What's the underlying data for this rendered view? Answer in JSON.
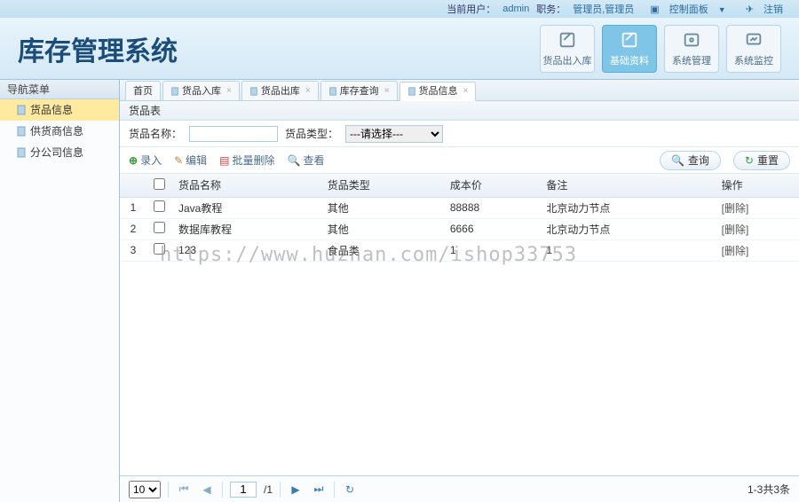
{
  "header": {
    "current_user_label": "当前用户：",
    "current_user": "admin",
    "role_label": "职务：",
    "role": "管理员,管理员",
    "control_panel": "控制面板",
    "logout": "注销"
  },
  "banner": {
    "title": "库存管理系统",
    "buttons": [
      {
        "label": "货品出入库"
      },
      {
        "label": "基础资料"
      },
      {
        "label": "系统管理"
      },
      {
        "label": "系统监控"
      }
    ]
  },
  "sidebar": {
    "title": "导航菜单",
    "items": [
      {
        "label": "货品信息"
      },
      {
        "label": "供货商信息"
      },
      {
        "label": "分公司信息"
      }
    ]
  },
  "tabs": [
    {
      "label": "首页",
      "closable": false
    },
    {
      "label": "货品入库",
      "closable": true
    },
    {
      "label": "货品出库",
      "closable": true
    },
    {
      "label": "库存查询",
      "closable": true
    },
    {
      "label": "货品信息",
      "closable": true
    }
  ],
  "panel": {
    "title": "货品表"
  },
  "search": {
    "name_label": "货品名称：",
    "type_label": "货品类型：",
    "type_placeholder": "---请选择---"
  },
  "toolbar": {
    "add": "录入",
    "edit": "编辑",
    "batch_delete": "批量删除",
    "view": "查看",
    "search": "查询",
    "reset": "重置"
  },
  "table": {
    "columns": [
      "货品名称",
      "货品类型",
      "成本价",
      "备注",
      "操作"
    ],
    "rows": [
      {
        "num": "1",
        "name": "Java教程",
        "type": "其他",
        "price": "88888",
        "remark": "北京动力节点",
        "op": "[删除]"
      },
      {
        "num": "2",
        "name": "数据库教程",
        "type": "其他",
        "price": "6666",
        "remark": "北京动力节点",
        "op": "[删除]"
      },
      {
        "num": "3",
        "name": "123",
        "type": "食品类",
        "price": "1",
        "remark": "1",
        "op": "[删除]"
      }
    ]
  },
  "pager": {
    "page_size": "10",
    "page": "1",
    "total_pages": "/1",
    "info": "1-3共3条"
  },
  "watermark": "https://www.huzhan.com/ishop33753"
}
